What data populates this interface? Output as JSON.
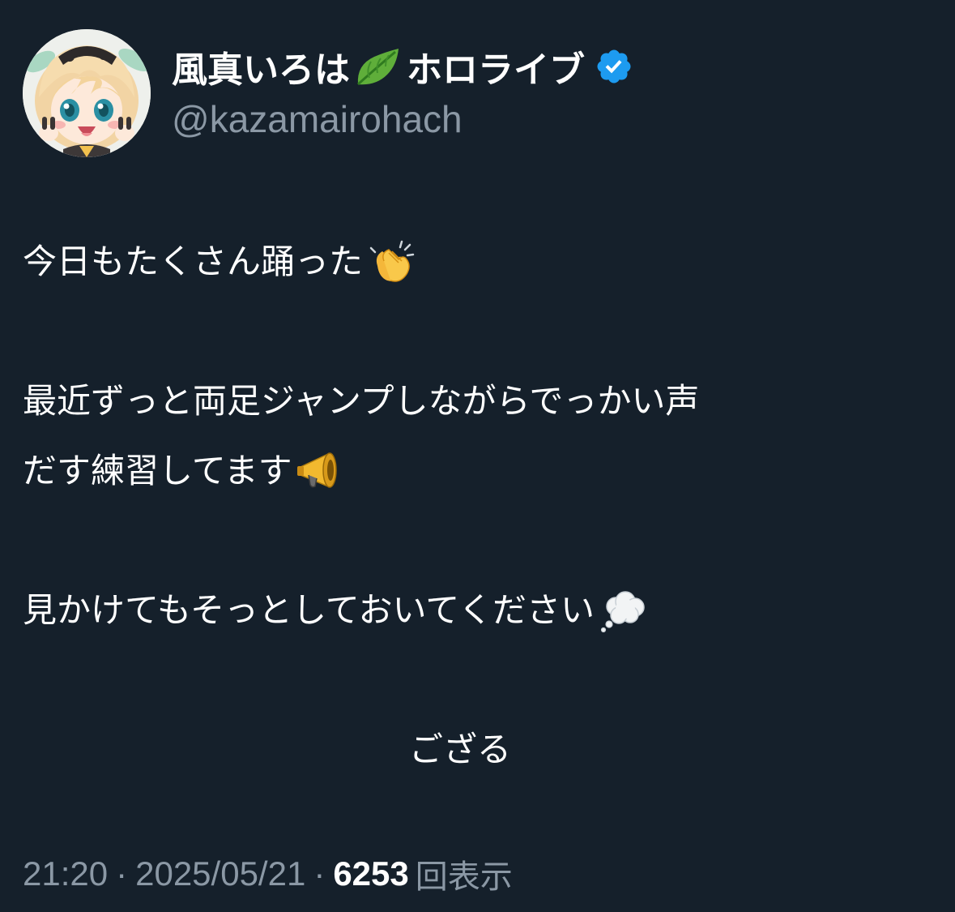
{
  "author": {
    "display_name": "風真いろは",
    "name_suffix": "ホロライブ",
    "handle": "@kazamairohach",
    "verified_color": "#1d9bf0",
    "name_icon": "leaf-icon",
    "verified_icon": "verified-badge-icon"
  },
  "tweet": {
    "lines": [
      "今日もたくさん踊った",
      "最近ずっと両足ジャンプしながらでっかい声",
      "だす練習してます",
      "見かけてもそっとしておいてください",
      "ござる"
    ],
    "emojis": [
      "clapping-hands-icon",
      "megaphone-icon",
      "thought-bubble-icon"
    ]
  },
  "meta": {
    "time": "21:20",
    "separator": "·",
    "date": "2025/05/21",
    "views_count": "6253",
    "views_label": "回表示"
  },
  "colors": {
    "background": "#15202b",
    "text": "#ffffff",
    "secondary": "#8b98a5"
  }
}
